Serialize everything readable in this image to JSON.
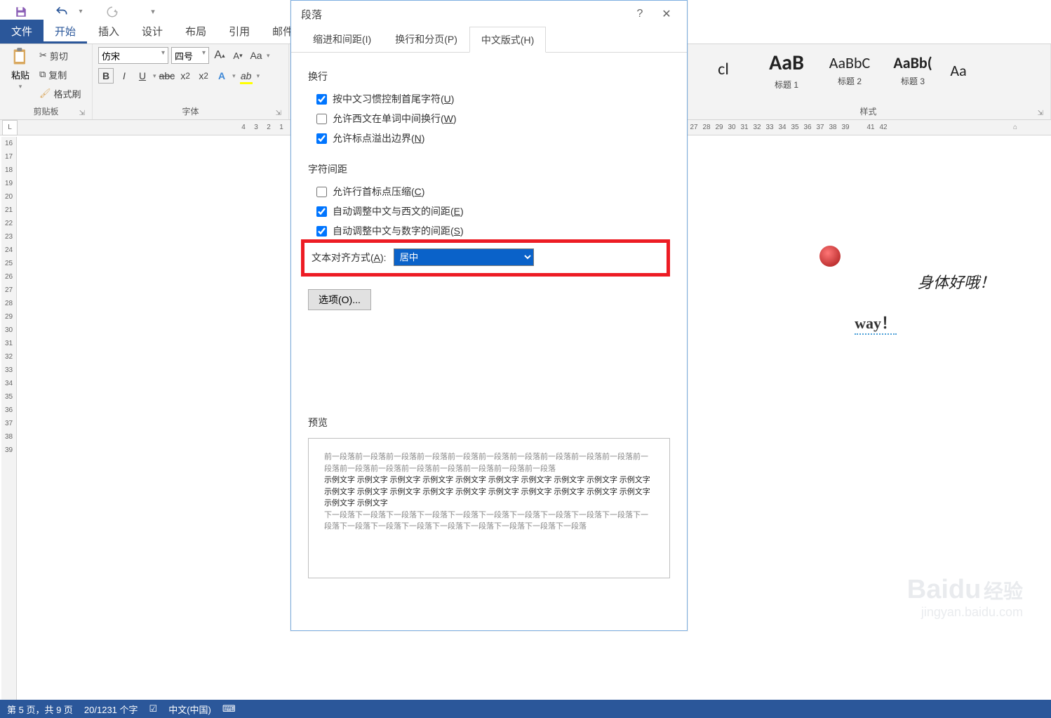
{
  "qat": {
    "save": "save",
    "undo": "undo",
    "redo": "redo"
  },
  "ribbon_tabs": [
    "文件",
    "开始",
    "插入",
    "设计",
    "布局",
    "引用",
    "邮件"
  ],
  "ribbon_active_tab": "开始",
  "clipboard": {
    "paste": "粘贴",
    "cut": "剪切",
    "copy": "复制",
    "format_painter": "格式刷",
    "group_label": "剪贴板"
  },
  "font": {
    "name": "仿宋",
    "size": "四号",
    "group_label": "字体",
    "aa_label": "Aa"
  },
  "styles": {
    "group_label": "样式",
    "items": [
      {
        "preview": "cl",
        "preview_size": "24px",
        "caption": ""
      },
      {
        "preview": "AaB",
        "preview_size": "30px",
        "caption": "标题 1"
      },
      {
        "preview": "AaBbC",
        "preview_size": "22px",
        "caption": "标题 2"
      },
      {
        "preview": "AaBb(",
        "preview_size": "22px",
        "caption": "标题 3"
      },
      {
        "preview": "Aa",
        "preview_size": "22px",
        "caption": ""
      }
    ]
  },
  "ruler_left_nums": [
    "4",
    "3",
    "2",
    "1"
  ],
  "ruler_right_nums": [
    "27",
    "28",
    "29",
    "30",
    "31",
    "32",
    "33",
    "34",
    "35",
    "36",
    "37",
    "38",
    "39",
    "",
    "41",
    "42"
  ],
  "ruler_v_nums": [
    "16",
    "17",
    "18",
    "19",
    "20",
    "21",
    "22",
    "23",
    "24",
    "25",
    "26",
    "27",
    "28",
    "29",
    "30",
    "31",
    "32",
    "33",
    "34",
    "35",
    "36",
    "37",
    "38",
    "39"
  ],
  "document": {
    "line1": "身体好哦！",
    "line2": "way！"
  },
  "statusbar": {
    "page": "第 5 页，共 9 页",
    "words": "20/1231 个字",
    "lang": "中文(中国)"
  },
  "dialog": {
    "title": "段落",
    "tabs": [
      "缩进和间距(I)",
      "换行和分页(P)",
      "中文版式(H)"
    ],
    "active_tab": 2,
    "section_wrap": "换行",
    "wrap_checks": [
      {
        "label": "按中文习惯控制首尾字符(",
        "hot": "U",
        "end": ")",
        "checked": true
      },
      {
        "label": "允许西文在单词中间换行(",
        "hot": "W",
        "end": ")",
        "checked": false
      },
      {
        "label": "允许标点溢出边界(",
        "hot": "N",
        "end": ")",
        "checked": true
      }
    ],
    "section_spacing": "字符间距",
    "spacing_checks": [
      {
        "label": "允许行首标点压缩(",
        "hot": "C",
        "end": ")",
        "checked": false
      },
      {
        "label": "自动调整中文与西文的间距(",
        "hot": "E",
        "end": ")",
        "checked": true
      },
      {
        "label": "自动调整中文与数字的间距(",
        "hot": "S",
        "end": ")",
        "checked": true
      }
    ],
    "align_label_pre": "文本对齐方式(",
    "align_hot": "A",
    "align_label_post": "):",
    "align_value": "居中",
    "options_btn": "选项(O)...",
    "preview_label": "预览",
    "preview_grey_top": "前一段落前一段落前一段落前一段落前一段落前一段落前一段落前一段落前一段落前一段落前一段落前一段落前一段落前一段落前一段落前一段落前一段落前一段落",
    "preview_dark": "示例文字 示例文字 示例文字 示例文字 示例文字 示例文字 示例文字 示例文字 示例文字 示例文字 示例文字 示例文字 示例文字 示例文字 示例文字 示例文字 示例文字 示例文字 示例文字 示例文字 示例文字 示例文字",
    "preview_grey_bot": "下一段落下一段落下一段落下一段落下一段落下一段落下一段落下一段落下一段落下一段落下一段落下一段落下一段落下一段落下一段落下一段落下一段落下一段落下一段落"
  },
  "watermark": {
    "brand": "Baidu",
    "sub": "经验",
    "url": "jingyan.baidu.com"
  }
}
